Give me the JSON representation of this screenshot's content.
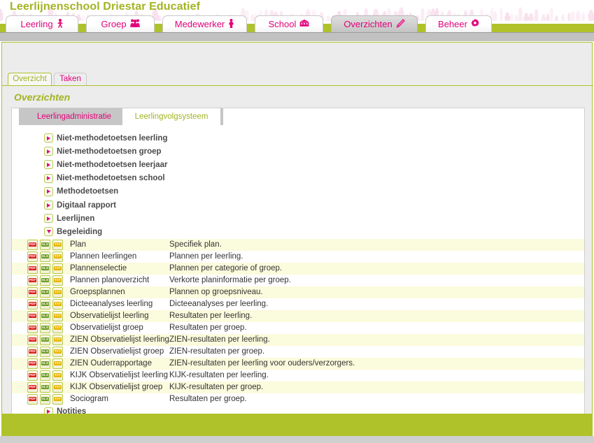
{
  "app": {
    "title": "Leerlijnenschool Driestar Educatief",
    "brand_olive": "#a2b423",
    "brand_pink": "#e2007a",
    "bar_green": "#b0c22a"
  },
  "main_tabs": [
    {
      "label": "Leerling",
      "icon": "person-icon",
      "glyph": "\u0001",
      "active": false
    },
    {
      "label": "Groep",
      "icon": "group-icon",
      "glyph": "\u0001",
      "active": false
    },
    {
      "label": "Medewerker",
      "icon": "employee-icon",
      "glyph": "\u0001",
      "active": false
    },
    {
      "label": "School",
      "icon": "building-icon",
      "glyph": "\u0001",
      "active": false
    },
    {
      "label": "Overzichten",
      "icon": "pencil-icon",
      "glyph": "\u0001",
      "active": true
    },
    {
      "label": "Beheer",
      "icon": "gear-icon",
      "glyph": "⚙",
      "active": false
    }
  ],
  "sub_tabs": [
    {
      "label": "Overzicht",
      "active": true
    },
    {
      "label": "Taken",
      "active": false
    }
  ],
  "page": {
    "title": "Overzichten"
  },
  "mode_buttons": [
    {
      "label": "Leerlingadministratie",
      "selected": false
    },
    {
      "label": "Leerlingvolgsysteem",
      "selected": true
    }
  ],
  "tree_top": [
    {
      "label": "Niet-methodetoetsen leerling",
      "expanded": false
    },
    {
      "label": "Niet-methodetoetsen groep",
      "expanded": false
    },
    {
      "label": "Niet-methodetoetsen leerjaar",
      "expanded": false
    },
    {
      "label": "Niet-methodetoetsen school",
      "expanded": false
    },
    {
      "label": "Methodetoetsen",
      "expanded": false
    },
    {
      "label": "Digitaal rapport",
      "expanded": false
    },
    {
      "label": "Leerlijnen",
      "expanded": false
    },
    {
      "label": "Begeleiding",
      "expanded": true
    }
  ],
  "export_icons": [
    {
      "name": "pdf-export-icon",
      "label": "PDF",
      "kind": "pdf"
    },
    {
      "name": "xls-export-icon",
      "label": "XLS",
      "kind": "xls"
    },
    {
      "name": "txt-export-icon",
      "label": "TXT",
      "kind": "txt"
    }
  ],
  "rows": [
    {
      "name": "Plan",
      "desc": "Specifiek plan."
    },
    {
      "name": "Plannen leerlingen",
      "desc": "Plannen per leerling."
    },
    {
      "name": "Plannenselectie",
      "desc": "Plannen per categorie of groep."
    },
    {
      "name": "Plannen planoverzicht",
      "desc": "Verkorte planinformatie per groep."
    },
    {
      "name": "Groepsplannen",
      "desc": "Plannen op groepsniveau."
    },
    {
      "name": "Dicteeanalyses leerling",
      "desc": "Dicteeanalyses per leerling."
    },
    {
      "name": "Observatielijst leerling",
      "desc": "Resultaten per leerling."
    },
    {
      "name": "Observatielijst groep",
      "desc": "Resultaten per groep."
    },
    {
      "name": "ZIEN Observatielijst leerling",
      "desc": "ZIEN-resultaten per leerling."
    },
    {
      "name": "ZIEN Observatielijst groep",
      "desc": "ZIEN-resultaten per groep."
    },
    {
      "name": "ZIEN Ouderrapportage",
      "desc": "ZIEN-resultaten per leerling voor ouders/verzorgers."
    },
    {
      "name": "KIJK Observatielijst leerling",
      "desc": "KIJK-resultaten per leerling."
    },
    {
      "name": "KIJK Observatielijst groep",
      "desc": "KIJK-resultaten per groep."
    },
    {
      "name": "Sociogram",
      "desc": "Resultaten per groep."
    }
  ],
  "tree_bottom": [
    {
      "label": "Notities",
      "expanded": false
    }
  ]
}
